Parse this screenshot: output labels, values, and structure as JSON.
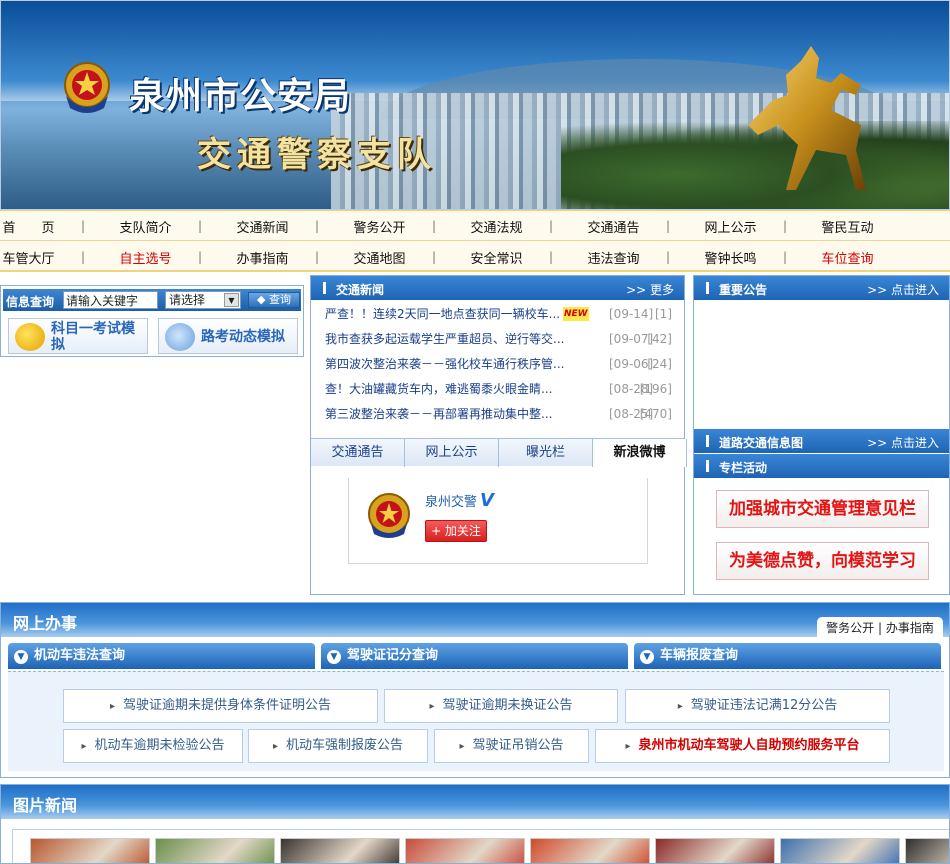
{
  "banner": {
    "title": "泉州市公安局",
    "subtitle": "交通警察支队"
  },
  "nav": {
    "row1": [
      {
        "label": "首　　页",
        "red": false
      },
      {
        "label": "支队简介",
        "red": false
      },
      {
        "label": "交通新闻",
        "red": false
      },
      {
        "label": "警务公开",
        "red": false
      },
      {
        "label": "交通法规",
        "red": false
      },
      {
        "label": "交通通告",
        "red": false
      },
      {
        "label": "网上公示",
        "red": false
      },
      {
        "label": "警民互动",
        "red": false
      }
    ],
    "row2": [
      {
        "label": "车管大厅",
        "red": false
      },
      {
        "label": "自主选号",
        "red": true
      },
      {
        "label": "办事指南",
        "red": false
      },
      {
        "label": "交通地图",
        "red": false
      },
      {
        "label": "安全常识",
        "red": false
      },
      {
        "label": "违法查询",
        "red": false
      },
      {
        "label": "警钟长鸣",
        "red": false
      },
      {
        "label": "车位查询",
        "red": true
      }
    ],
    "separator": "|"
  },
  "search": {
    "label": "信息查询",
    "placeholder": "请输入关键字",
    "select_value": "请选择",
    "button": "查询"
  },
  "quick": {
    "exam": "科目一考试模拟",
    "road": "路考动态模拟"
  },
  "news": {
    "title": "交通新闻",
    "more": ">> 更多",
    "items": [
      {
        "text": "严查！！连续2天同一地点查获同一辆校车...",
        "date": "[09-14]",
        "count": "[1]",
        "new": "NEW"
      },
      {
        "text": "我市查获多起运载学生严重超员、逆行等交...",
        "date": "[09-07]",
        "count": "[42]",
        "new": ""
      },
      {
        "text": "第四波次整治来袭－－强化校车通行秩序管...",
        "date": "[09-06]",
        "count": "[24]",
        "new": ""
      },
      {
        "text": "查！大油罐藏货车内，难逃蜀黍火眼金睛...",
        "date": "[08-28]",
        "count": "[196]",
        "new": ""
      },
      {
        "text": "第三波整治来袭－－再部署再推动集中整...",
        "date": "[08-25]",
        "count": "[470]",
        "new": ""
      }
    ]
  },
  "tabs": [
    "交通通告",
    "网上公示",
    "曝光栏",
    "新浪微博"
  ],
  "weibo": {
    "name": "泉州交警",
    "verified": "V",
    "follow": "+ 加关注"
  },
  "right": {
    "notice_title": "重要公告",
    "notice_more": ">> 点击进入",
    "road_title": "道路交通信息图",
    "road_more": ">> 点击进入",
    "column_title": "专栏活动",
    "btn1": "加强城市交通管理意见栏",
    "btn2": "为美德点赞，向模范学习"
  },
  "online": {
    "title": "网上办事",
    "links": "警务公开 | 办事指南",
    "cats": [
      "机动车违法查询",
      "驾驶证记分查询",
      "车辆报废查询"
    ],
    "row1": [
      {
        "label": "驾驶证逾期未提供身体条件证明公告",
        "red": false
      },
      {
        "label": "驾驶证逾期未换证公告",
        "red": false
      },
      {
        "label": "驾驶证违法记满12分公告",
        "red": false
      }
    ],
    "row2": [
      {
        "label": "机动车逾期未检验公告",
        "red": false
      },
      {
        "label": "机动车强制报废公告",
        "red": false
      },
      {
        "label": "驾驶证吊销公告",
        "red": false
      },
      {
        "label": "泉州市机动车驾驶人自助预约服务平台",
        "red": true
      }
    ]
  },
  "pics": {
    "title": "图片新闻"
  },
  "colors": {
    "blue_header": "#1e64b4",
    "link_red": "#d40000",
    "nav_bg": "#fffaee"
  }
}
